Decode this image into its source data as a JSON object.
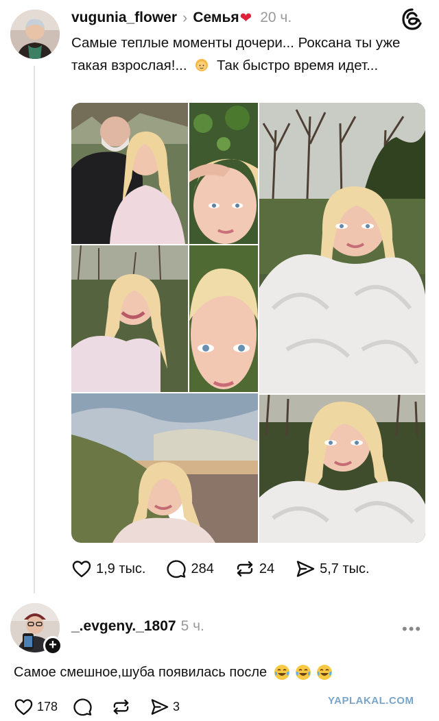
{
  "post": {
    "username": "vugunia_flower",
    "chevron": "›",
    "community": "Семья",
    "community_emoji": "❤",
    "timestamp": "20 ч.",
    "text_part1": "Самые теплые моменты дочери... Роксана ты уже такая взрослая!...",
    "text_part2": "Так быстро время идет...",
    "emoji_name": "person-blond-emoji",
    "icons": {
      "avatar": "user-avatar",
      "app": "threads-logo-icon"
    },
    "photo_tiles": [
      {
        "name": "photo-man-and-woman",
        "scene": "elderly man with blonde woman selfie"
      },
      {
        "name": "photo-face-close",
        "scene": "close-up face with hand on forehead"
      },
      {
        "name": "photo-fur-coat-large",
        "scene": "woman in white fur coat outdoors"
      },
      {
        "name": "photo-smiling-selfie",
        "scene": "smiling woman in pink sweater"
      },
      {
        "name": "photo-face-closeup-2",
        "scene": "close-up face blue eyes"
      },
      {
        "name": "photo-seaside",
        "scene": "woman at seaside cliff"
      },
      {
        "name": "photo-fur-coat-2",
        "scene": "woman in fur coat by trees"
      }
    ]
  },
  "actions": {
    "likes": "1,9 тыс.",
    "replies": "284",
    "reposts": "24",
    "shares": "5,7 тыс."
  },
  "comment": {
    "username": "_.evgeny._1807",
    "timestamp": "5 ч.",
    "more": "•••",
    "text": "Самое смешное,шуба появилась после",
    "emoji_name": "face-with-tears-of-joy-emoji",
    "follow_badge": "+",
    "likes": "178",
    "shares": "3"
  },
  "watermark": "YAPLAKAL.COM",
  "colors": {
    "text": "#111111",
    "muted": "#9a9a9a",
    "heart": "#e0213a",
    "watermark": "#7aa4c9"
  }
}
